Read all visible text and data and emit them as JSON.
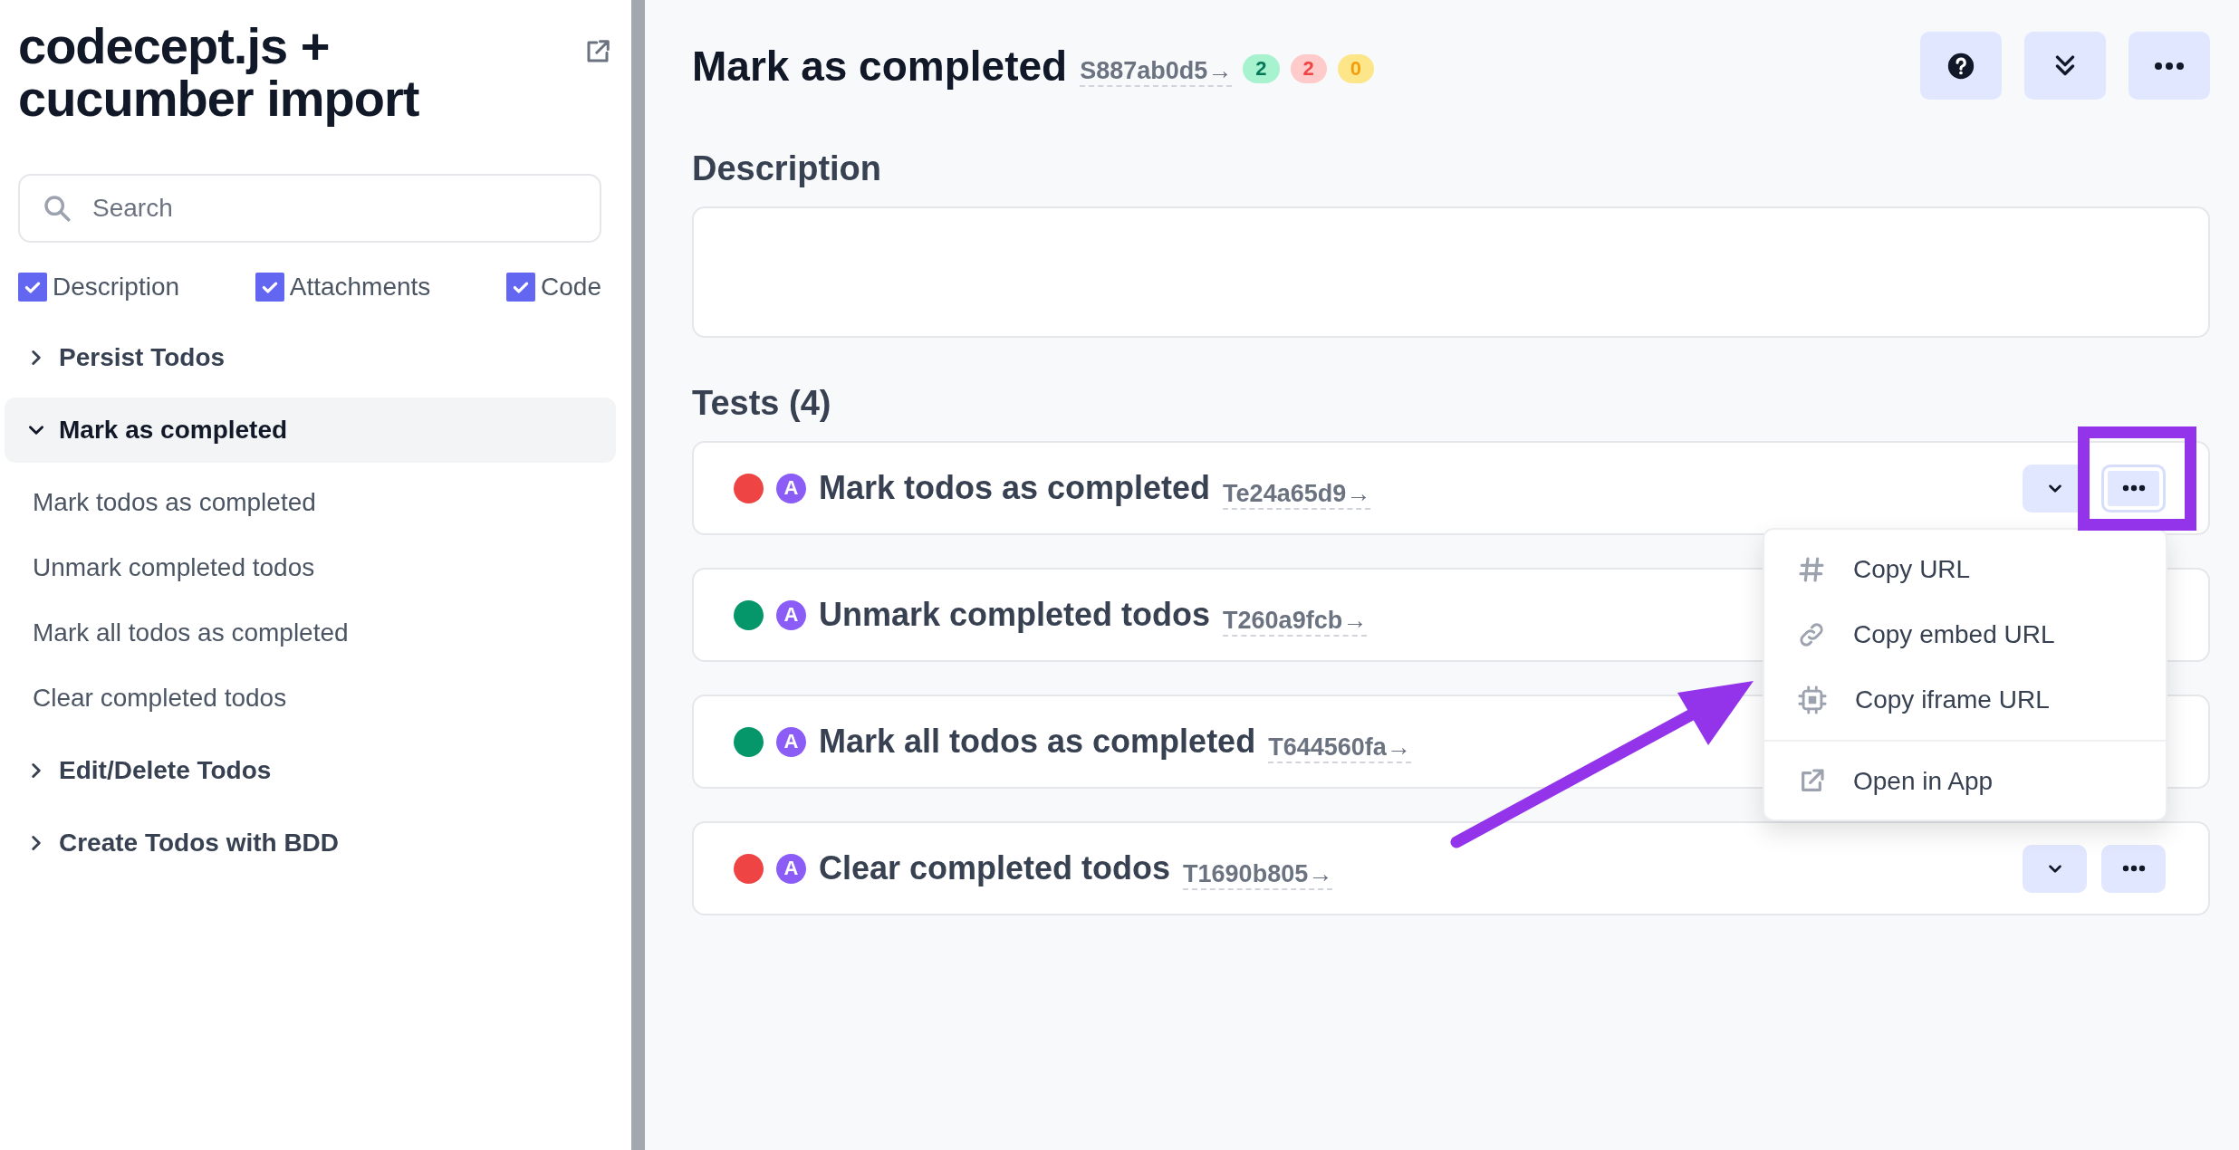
{
  "sidebar": {
    "title": "codecept.js + cucumber import",
    "search": {
      "placeholder": "Search"
    },
    "filters": [
      {
        "label": "Description",
        "checked": true
      },
      {
        "label": "Attachments",
        "checked": true
      },
      {
        "label": "Code",
        "checked": true
      }
    ],
    "tree": [
      {
        "label": "Persist Todos",
        "expanded": false,
        "selected": false
      },
      {
        "label": "Mark as completed",
        "expanded": true,
        "selected": true,
        "children": [
          {
            "label": "Mark todos as completed",
            "selected": false
          },
          {
            "label": "Unmark completed todos",
            "selected": false
          },
          {
            "label": "Mark all todos as completed",
            "selected": false
          },
          {
            "label": "Clear completed todos",
            "selected": false
          }
        ]
      },
      {
        "label": "Edit/Delete Todos",
        "expanded": false,
        "selected": false
      },
      {
        "label": "Create Todos with BDD",
        "expanded": false,
        "selected": false
      }
    ]
  },
  "main": {
    "title": "Mark as completed",
    "id": "S887ab0d5→",
    "counts": [
      {
        "value": "2",
        "kind": "passed"
      },
      {
        "value": "2",
        "kind": "failed"
      },
      {
        "value": "0",
        "kind": "skipped"
      }
    ],
    "description_heading": "Description",
    "tests_heading": "Tests (4)",
    "tests": [
      {
        "color": "#ef4444",
        "badge": "A",
        "title": "Mark todos as completed",
        "id": "Te24a65d9→",
        "show_actions": true,
        "more_focused": true
      },
      {
        "color": "#059669",
        "badge": "A",
        "title": "Unmark completed todos",
        "id": "T260a9fcb→",
        "show_actions": false
      },
      {
        "color": "#059669",
        "badge": "A",
        "title": "Mark all todos as completed",
        "id": "T644560fa→",
        "show_actions": false
      },
      {
        "color": "#ef4444",
        "badge": "A",
        "title": "Clear completed todos",
        "id": "T1690b805→",
        "show_actions": true,
        "more_focused": false
      }
    ],
    "menu": {
      "items": [
        {
          "label": "Copy URL",
          "kind": "hash"
        },
        {
          "label": "Copy embed URL",
          "kind": "link"
        },
        {
          "label": "Copy iframe URL",
          "kind": "chip"
        },
        {
          "label": "Open in App",
          "kind": "external"
        }
      ]
    }
  }
}
